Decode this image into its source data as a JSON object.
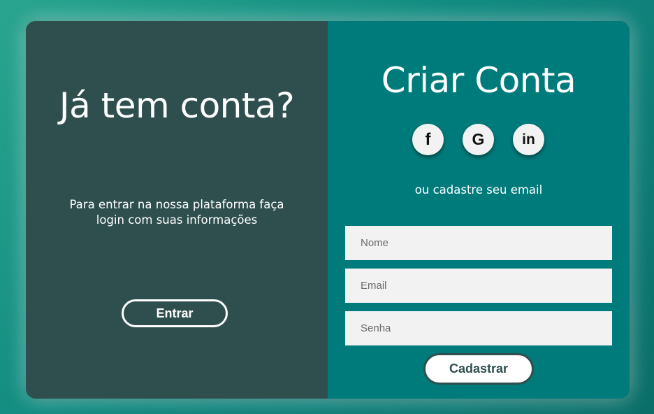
{
  "login_panel": {
    "title": "Já tem conta?",
    "description": "Para entrar na nossa plataforma faça login com suas informações",
    "button_label": "Entrar"
  },
  "signup_panel": {
    "title": "Criar Conta",
    "social": [
      {
        "name": "facebook-icon",
        "label": "f"
      },
      {
        "name": "google-icon",
        "label": "G"
      },
      {
        "name": "linkedin-icon",
        "label": "in"
      }
    ],
    "or_text": "ou cadastre seu email",
    "fields": {
      "name": {
        "placeholder": "Nome",
        "value": ""
      },
      "email": {
        "placeholder": "Email",
        "value": ""
      },
      "password": {
        "placeholder": "Senha",
        "value": ""
      }
    },
    "button_label": "Cadastrar"
  },
  "colors": {
    "left_panel_bg": "#2f4f4f",
    "right_panel_bg": "#007b7b",
    "input_bg": "#f2f2f2"
  }
}
